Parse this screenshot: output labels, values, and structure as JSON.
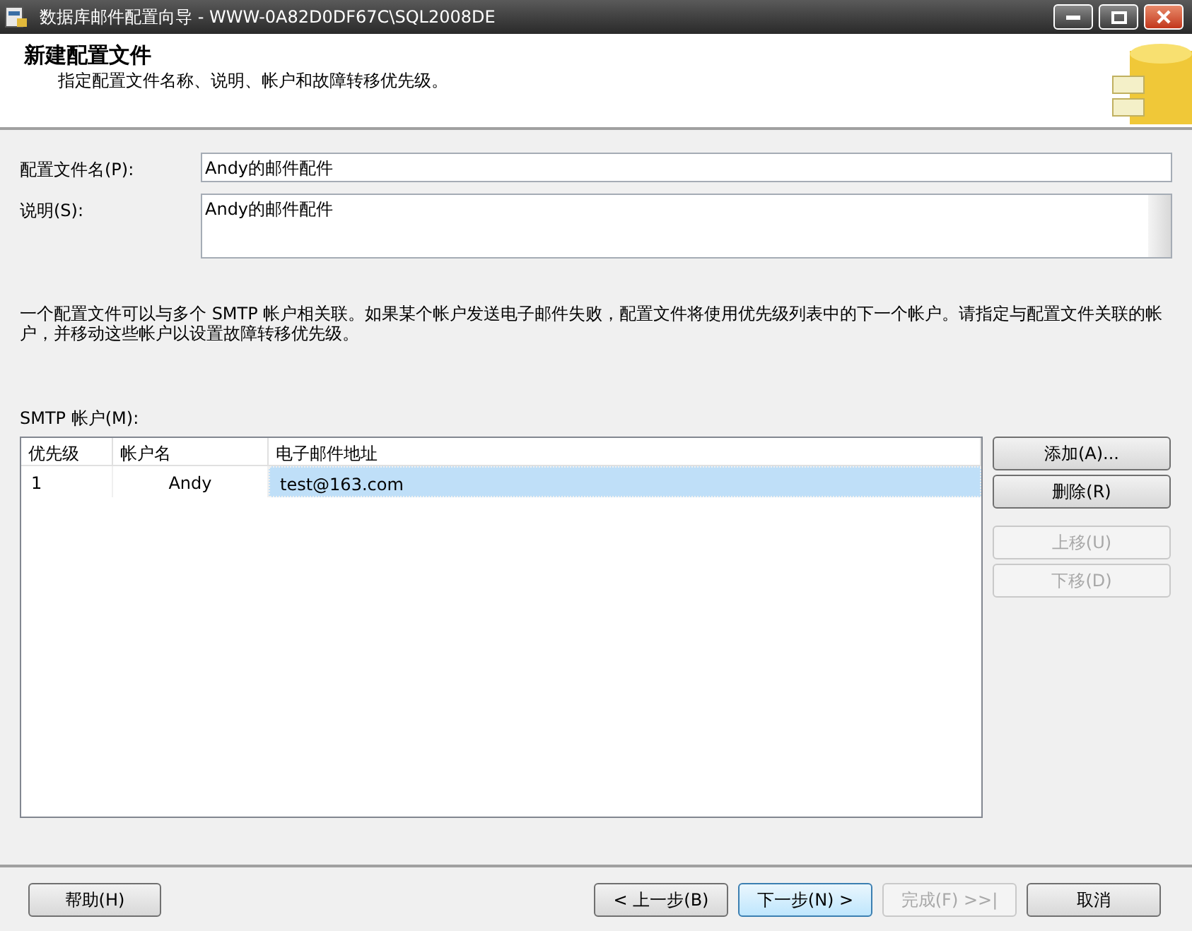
{
  "window": {
    "title": "数据库邮件配置向导 - WWW-0A82D0DF67C\\SQL2008DE"
  },
  "header": {
    "title": "新建配置文件",
    "subtitle": "指定配置文件名称、说明、帐户和故障转移优先级。"
  },
  "fields": [
    {
      "kind": "line",
      "label": "配置文件名(P):",
      "value": "Andy的邮件配件"
    },
    {
      "kind": "area",
      "label": "说明(S):",
      "value": "Andy的邮件配件"
    }
  ],
  "description": "一个配置文件可以与多个 SMTP 帐户相关联。如果某个帐户发送电子邮件失败，配置文件将使用优先级列表中的下一个帐户。请指定与配置文件关联的帐户，并移动这些帐户以设置故障转移优先级。",
  "accounts_label": "SMTP 帐户(M):",
  "table": {
    "columns": [
      "优先级",
      "帐户名",
      "电子邮件地址"
    ],
    "rows": [
      {
        "cells": [
          "1",
          "Andy",
          "test@163.com"
        ],
        "selected": true
      }
    ]
  },
  "side_buttons": [
    {
      "label": "添加(A)...",
      "disabled": false
    },
    {
      "label": "删除(R)",
      "disabled": false
    },
    {
      "label": "上移(U)",
      "disabled": true
    },
    {
      "label": "下移(D)",
      "disabled": true
    }
  ],
  "footer_left": [
    {
      "label": "帮助(H)",
      "disabled": false,
      "hot": false
    }
  ],
  "footer_right": [
    {
      "label": "< 上一步(B)",
      "disabled": false,
      "hot": false
    },
    {
      "label": "下一步(N) >",
      "disabled": false,
      "hot": true
    },
    {
      "label": "完成(F) >>|",
      "disabled": true,
      "hot": false
    },
    {
      "label": "取消",
      "disabled": false,
      "hot": false
    }
  ]
}
